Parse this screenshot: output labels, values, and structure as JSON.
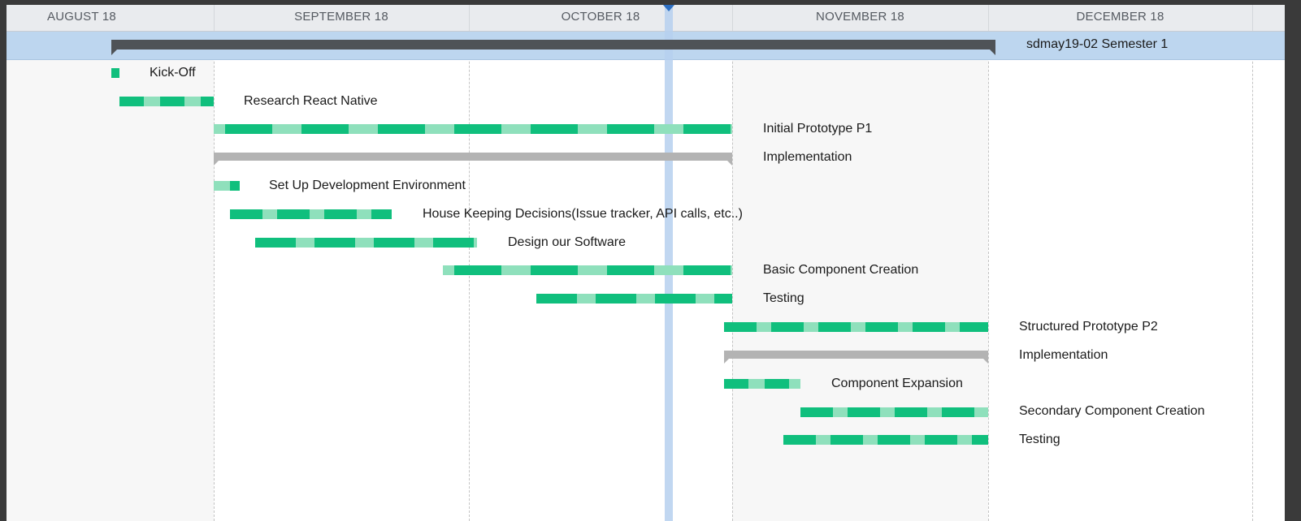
{
  "timeline": {
    "months": [
      "AUGUST 18",
      "SEPTEMBER 18",
      "OCTOBER 18",
      "NOVEMBER 18",
      "DECEMBER 18"
    ]
  },
  "summary": {
    "label": "sdmay19-02 Semester 1"
  },
  "tasks": [
    {
      "label": "Kick-Off",
      "kind": "milestone"
    },
    {
      "label": "Research React Native",
      "kind": "task"
    },
    {
      "label": "Initial Prototype P1",
      "kind": "task"
    },
    {
      "label": "Implementation",
      "kind": "group"
    },
    {
      "label": "Set Up Development Environment",
      "kind": "task"
    },
    {
      "label": "House Keeping Decisions(Issue tracker, API calls, etc..)",
      "kind": "task"
    },
    {
      "label": "Design our Software",
      "kind": "task"
    },
    {
      "label": "Basic Component Creation",
      "kind": "task"
    },
    {
      "label": "Testing",
      "kind": "task"
    },
    {
      "label": "Structured Prototype P2",
      "kind": "task"
    },
    {
      "label": "Implementation",
      "kind": "group"
    },
    {
      "label": "Component Expansion",
      "kind": "task"
    },
    {
      "label": "Secondary Component Creation",
      "kind": "task"
    },
    {
      "label": "Testing",
      "kind": "task"
    }
  ],
  "colors": {
    "task_bar": "#10bf7d",
    "task_bar_light": "#8fe0bc",
    "group_bar": "#b3b3b3",
    "summary_bar": "#4f5357",
    "summary_band": "#bdd6ef",
    "today_marker": "#2d6fc2"
  }
}
